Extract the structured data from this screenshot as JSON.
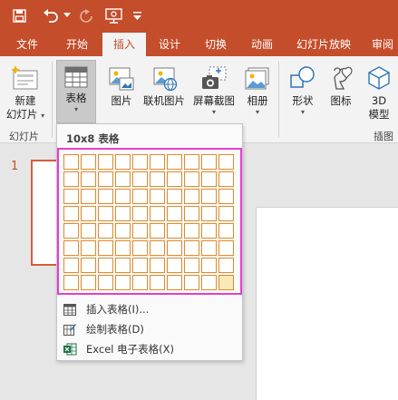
{
  "qat": {
    "save_icon": "save-icon",
    "undo_icon": "undo-icon",
    "redo_icon": "redo-icon",
    "slideshow_icon": "present-from-start-icon",
    "customize_icon": "customize-qat-icon"
  },
  "tabs": [
    {
      "label": "文件"
    },
    {
      "label": "开始"
    },
    {
      "label": "插入"
    },
    {
      "label": "设计"
    },
    {
      "label": "切换"
    },
    {
      "label": "动画"
    },
    {
      "label": "幻灯片放映"
    },
    {
      "label": "审阅"
    }
  ],
  "active_tab": "插入",
  "ribbon": {
    "new_slide_line1": "新建",
    "new_slide_line2": "幻灯片",
    "table": "表格",
    "picture": "图片",
    "online_picture": "联机图片",
    "screenshot": "屏幕截图",
    "album": "相册",
    "shapes": "形状",
    "icons": "图标",
    "model3d_line1": "3D",
    "model3d_line2": "模型",
    "group_slides": "幻灯片",
    "group_illustrations": "插图"
  },
  "workspace": {
    "slide_number": "1"
  },
  "table_menu": {
    "size_label": "10x8 表格",
    "columns": 10,
    "rows": 8,
    "highlight_cols": 10,
    "highlight_rows": 8,
    "items": [
      {
        "label": "插入表格(I)...",
        "icon": "insert-table-icon"
      },
      {
        "label": "绘制表格(D)",
        "icon": "draw-table-icon"
      },
      {
        "label": "Excel 电子表格(X)",
        "icon": "excel-spreadsheet-icon"
      }
    ]
  },
  "colors": {
    "accent": "#c44d2b",
    "selection_border": "#e43ed1",
    "cell_highlight": "#e08a2d",
    "last_cell_fill": "#f8e9b8"
  }
}
